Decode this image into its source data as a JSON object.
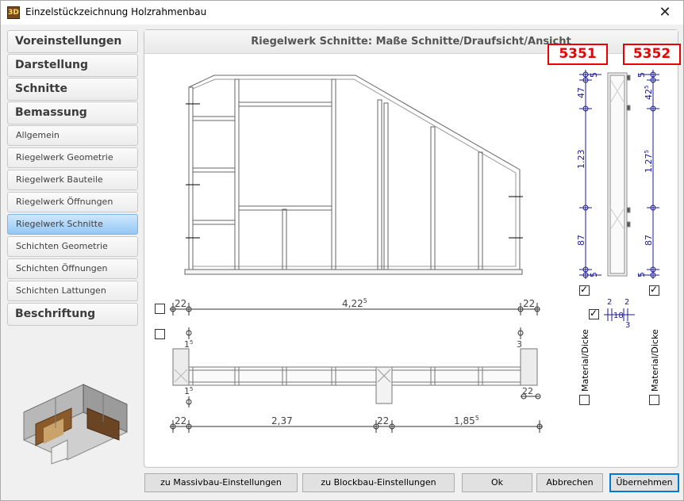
{
  "window": {
    "title": "Einzelstückzeichnung Holzrahmenbau",
    "icon_text": "3D"
  },
  "nav": {
    "items": [
      {
        "label": "Voreinstellungen",
        "type": "main"
      },
      {
        "label": "Darstellung",
        "type": "main"
      },
      {
        "label": "Schnitte",
        "type": "main"
      },
      {
        "label": "Bemassung",
        "type": "main"
      },
      {
        "label": "Allgemein",
        "type": "sub"
      },
      {
        "label": "Riegelwerk Geometrie",
        "type": "sub"
      },
      {
        "label": "Riegelwerk Bauteile",
        "type": "sub"
      },
      {
        "label": "Riegelwerk Öffnungen",
        "type": "sub"
      },
      {
        "label": "Riegelwerk Schnitte",
        "type": "sub",
        "active": true
      },
      {
        "label": "Schichten Geometrie",
        "type": "sub"
      },
      {
        "label": "Schichten Öffnungen",
        "type": "sub"
      },
      {
        "label": "Schichten Lattungen",
        "type": "sub"
      },
      {
        "label": "Beschriftung",
        "type": "main"
      }
    ]
  },
  "panel": {
    "header": "Riegelwerk Schnitte: Maße Schnitte/Draufsicht/Ansicht"
  },
  "labels": {
    "left_code": "5351",
    "right_code": "5352",
    "material_left": "Material/Dicke",
    "material_right": "Material/Dicke"
  },
  "dims": {
    "top_left": "22",
    "top_mid": "4,22",
    "top_mid_sup": "5",
    "top_right": "22",
    "sec_left_a": "1",
    "sec_left_a_sup": "5",
    "sec_right": "3",
    "sec_left_b": "1",
    "sec_left_b_sup": "5",
    "sec_right_b": "22",
    "bot_1": "22",
    "bot_2": "2,37",
    "bot_3": "22",
    "bot_4": "1,85",
    "bot_4_sup": "5",
    "v_left": [
      "5",
      "47",
      "1.23",
      "87",
      "5"
    ],
    "v_right": [
      "5",
      "42",
      "5",
      "1.27",
      "5",
      "87",
      "5"
    ],
    "thick_a": "2",
    "thick_b": "2",
    "thick_c": "18",
    "thick_d": "3"
  },
  "checkboxes": {
    "top_dim": false,
    "section_dim": false,
    "left_vertical": true,
    "right_vertical": true,
    "thickness": true,
    "material_left": false,
    "material_right": false
  },
  "buttons": {
    "massiv": "zu Massivbau-Einstellungen",
    "block": "zu Blockbau-Einstellungen",
    "ok": "Ok",
    "cancel": "Abbrechen",
    "apply": "Übernehmen"
  },
  "colors": {
    "dim_blue": "#1b1b8f",
    "active_nav": "#92c7f4",
    "code_red": "#e00000"
  }
}
